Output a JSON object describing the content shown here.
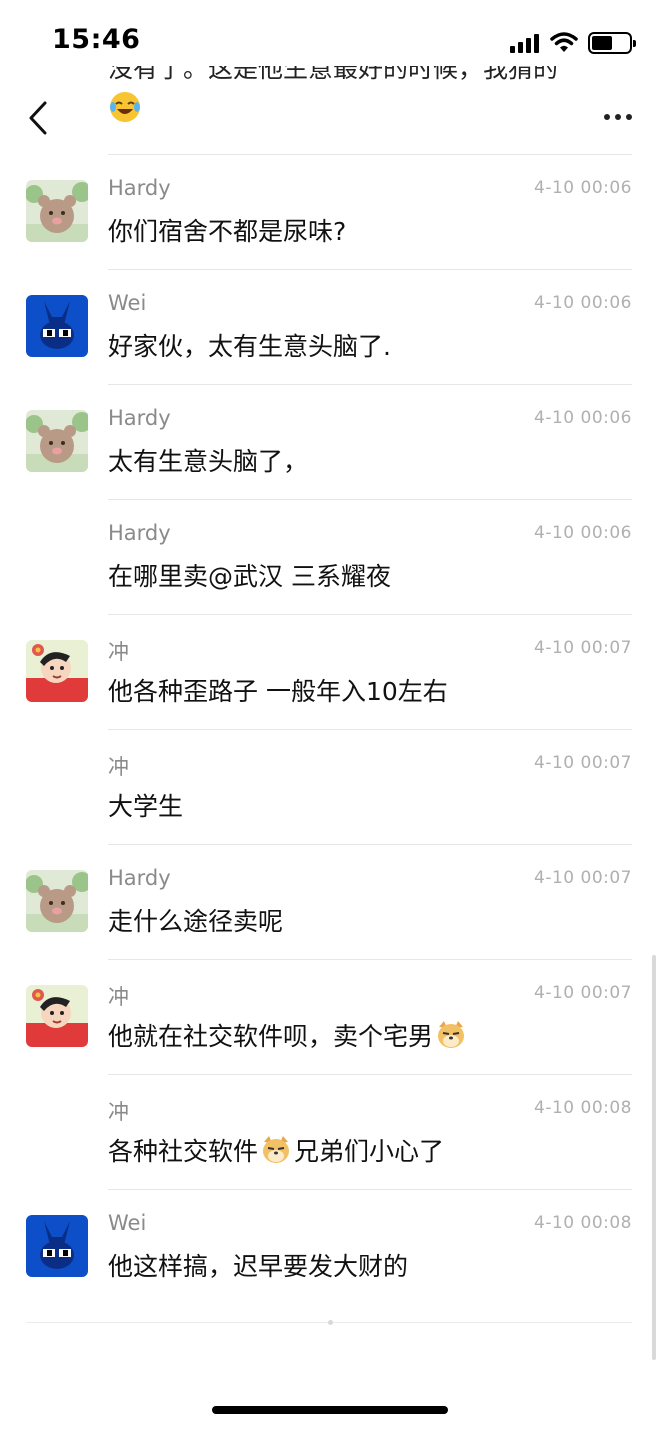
{
  "status_bar": {
    "time": "15:46"
  },
  "nav": {
    "back_icon": "chevron-left-icon",
    "more_icon": "more-horizontal-icon"
  },
  "previous_message": {
    "text_fragment": "没有了。这是他生意最好的时候，我猜的",
    "emoji": "laughing-crying-emoji"
  },
  "messages": [
    {
      "name": "Hardy",
      "time": "4-10 00:06",
      "text": "你们宿舍不都是尿味?",
      "avatar": "bear-avatar",
      "show_avatar": true
    },
    {
      "name": "Wei",
      "time": "4-10 00:06",
      "text": "好家伙，太有生意头脑了.",
      "avatar": "blue-rabbit-avatar",
      "show_avatar": true
    },
    {
      "name": "Hardy",
      "time": "4-10 00:06",
      "text": "太有生意头脑了，",
      "avatar": "bear-avatar",
      "show_avatar": true
    },
    {
      "name": "Hardy",
      "time": "4-10 00:06",
      "text": "在哪里卖@武汉 三系耀夜",
      "avatar": "",
      "show_avatar": false
    },
    {
      "name": "冲",
      "time": "4-10 00:07",
      "text": "他各种歪路子 一般年入10左右",
      "avatar": "cartoon-kid-avatar",
      "show_avatar": true
    },
    {
      "name": "冲",
      "time": "4-10 00:07",
      "text": "大学生",
      "avatar": "",
      "show_avatar": false
    },
    {
      "name": "Hardy",
      "time": "4-10 00:07",
      "text": "走什么途径卖呢",
      "avatar": "bear-avatar",
      "show_avatar": true
    },
    {
      "name": "冲",
      "time": "4-10 00:07",
      "text": "他就在社交软件呗，卖个宅男",
      "text_after": "",
      "emoji": "doge-emoji",
      "avatar": "cartoon-kid-avatar",
      "show_avatar": true
    },
    {
      "name": "冲",
      "time": "4-10 00:08",
      "text": "各种社交软件",
      "text_after": "兄弟们小心了",
      "emoji": "doge-emoji",
      "avatar": "",
      "show_avatar": false
    },
    {
      "name": "Wei",
      "time": "4-10 00:08",
      "text": "他这样搞，迟早要发大财的",
      "avatar": "blue-rabbit-avatar",
      "show_avatar": true
    }
  ]
}
